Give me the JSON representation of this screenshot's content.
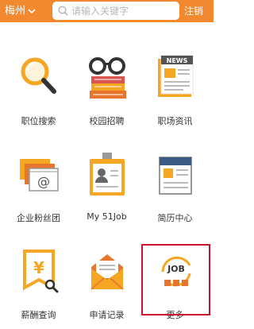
{
  "header": {
    "city": "梅州",
    "search_placeholder": "请输入关键字",
    "logout_label": "注销"
  },
  "menu": [
    {
      "label": "职位搜索"
    },
    {
      "label": "校园招聘"
    },
    {
      "label": "职场资讯"
    },
    {
      "label": "企业粉丝团"
    },
    {
      "label": "My 51Job"
    },
    {
      "label": "简历中心"
    },
    {
      "label": "薪酬查询"
    },
    {
      "label": "申请记录"
    },
    {
      "label": "更多"
    }
  ],
  "icons": {
    "news_text": "NEWS",
    "job_text": "JOB",
    "yuan_text": "¥",
    "at_text": "@"
  },
  "colors": {
    "brand": "#f2892e",
    "icon_orange": "#f5a623",
    "icon_dark": "#333333",
    "highlight": "#c8102e"
  }
}
